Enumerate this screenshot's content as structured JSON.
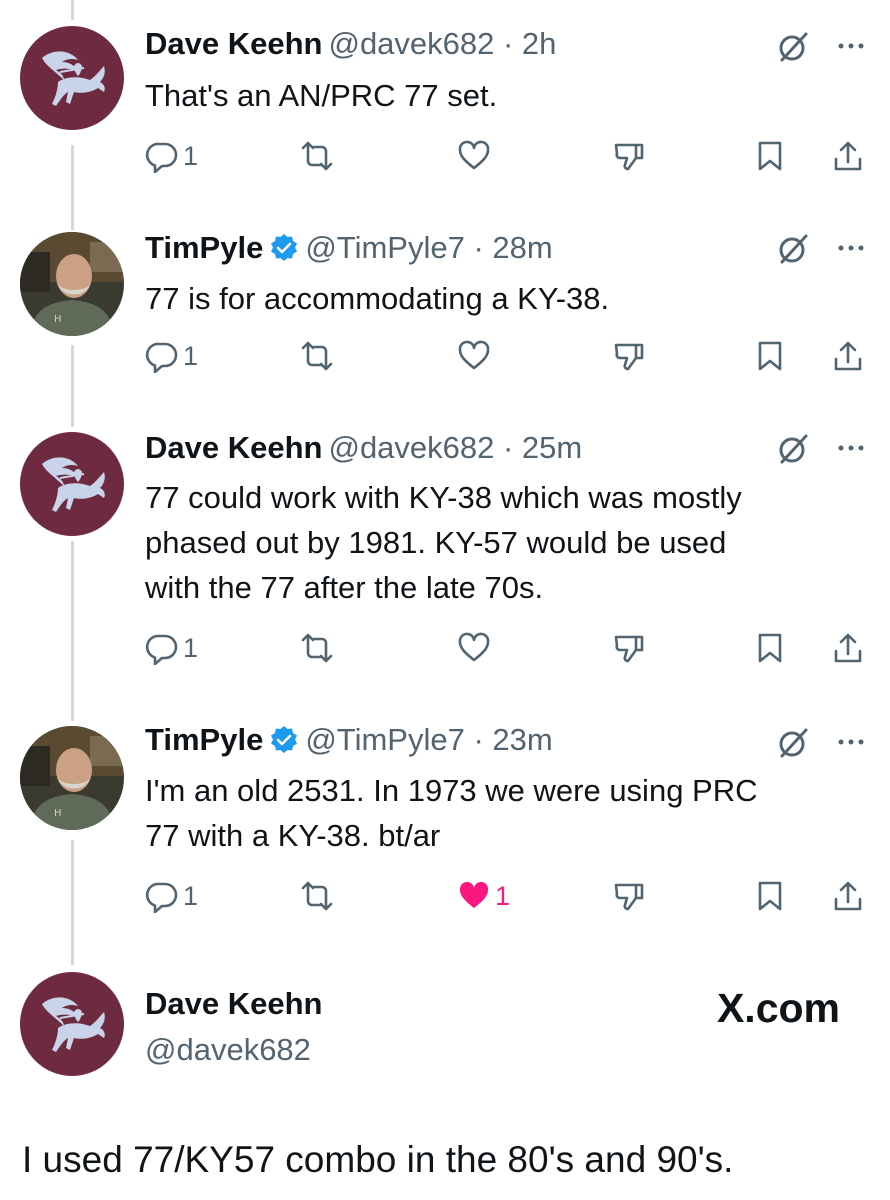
{
  "tweets": [
    {
      "name": "Dave Keehn",
      "handle_time": "@davek682 · 2h",
      "verified": false,
      "text": "That's an AN/PRC 77 set.",
      "replies": "1",
      "likes": "",
      "liked": false,
      "avatar": "pegasus"
    },
    {
      "name": "TimPyle",
      "handle_time": "@TimPyle7 · 28m",
      "verified": true,
      "text": "77 is for accommodating a KY-38.",
      "replies": "1",
      "likes": "",
      "liked": false,
      "avatar": "photo"
    },
    {
      "name": "Dave Keehn",
      "handle_time": "@davek682 · 25m",
      "verified": false,
      "text_lines": [
        "77 could work with KY-38 which was mostly",
        "phased out by 1981. KY-57 would be used",
        "with the 77 after the late 70s."
      ],
      "replies": "1",
      "likes": "",
      "liked": false,
      "avatar": "pegasus"
    },
    {
      "name": "TimPyle",
      "handle_time": "@TimPyle7 · 23m",
      "verified": true,
      "text_lines": [
        "I'm an old 2531.  In 1973 we were using PRC",
        "77 with a KY-38.  bt/ar"
      ],
      "replies": "1",
      "likes": "1",
      "liked": true,
      "avatar": "photo"
    }
  ],
  "profile": {
    "name": "Dave Keehn",
    "handle": "@davek682",
    "site": "X.com"
  },
  "caption": "I used 77/KY57 combo in the 80's and 90's.",
  "icons": {
    "reply": "reply-icon",
    "retweet": "retweet-icon",
    "like": "heart-icon",
    "dislike": "thumbs-down-icon",
    "bookmark": "bookmark-icon",
    "share": "share-icon",
    "grok": "grok-icon",
    "more": "more-icon",
    "verified": "verified-badge-icon"
  },
  "colors": {
    "text": "#0f1419",
    "muted": "#536471",
    "like": "#f91880",
    "verified": "#1d9bf0",
    "thread": "#cfd9de",
    "avatar_bg": "#6e2a3e"
  }
}
